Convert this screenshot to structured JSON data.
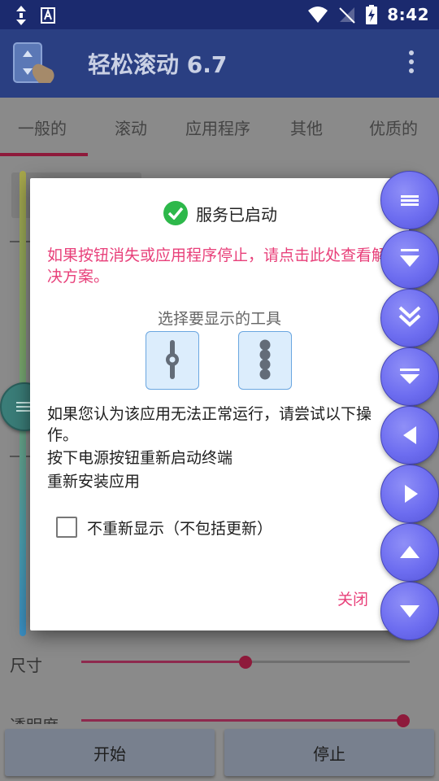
{
  "status_bar": {
    "time": "8:42"
  },
  "app_bar": {
    "title": "轻松滚动 6.7"
  },
  "tabs": [
    {
      "label": "一般的"
    },
    {
      "label": "滚动"
    },
    {
      "label": "应用程序"
    },
    {
      "label": "其他"
    },
    {
      "label": "优质的"
    }
  ],
  "background": {
    "size_label": "尺寸",
    "opacity_label": "透明度",
    "partial_text": "钮",
    "size_slider_value": 0.5,
    "opacity_slider_value": 0.98
  },
  "bottom_buttons": {
    "start": "开始",
    "stop": "停止"
  },
  "dialog": {
    "title": "服务已启动",
    "warning": "如果按钮消失或应用程序停止，请点击此处查看解决方案。",
    "choose_tool": "选择要显示的工具",
    "troubleshoot_intro": "如果您认为该应用无法正常运行，请尝试以下操作。",
    "step1": "按下电源按钮重新启动终端",
    "step2": "重新安装应用",
    "dont_show_again": "不重新显示（不包括更新）",
    "dont_show_checked": false,
    "close": "关闭"
  },
  "colors": {
    "status_bar": "#1b2a6e",
    "app_bar": "#2a3f82",
    "accent_pink": "#e8407a",
    "tab_indicator": "#8e1a3b",
    "floating_button": "#6d6df0",
    "check_green": "#2db84a"
  }
}
